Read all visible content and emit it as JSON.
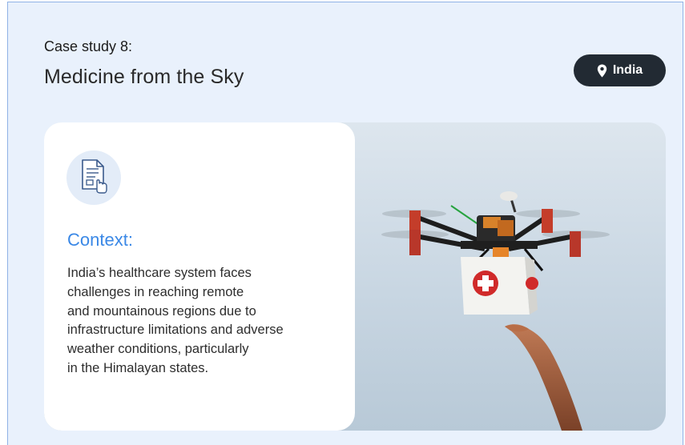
{
  "header": {
    "eyebrow": "Case study 8:",
    "title": "Medicine from the Sky"
  },
  "location_badge": {
    "label": "India",
    "icon": "map-pin-icon"
  },
  "context": {
    "icon": "document-touch-icon",
    "heading": "Context:",
    "lines": [
      "India’s healthcare system faces",
      "challenges in reaching remote",
      "and mountainous regions due to",
      "infrastructure limitations and adverse",
      "weather conditions, particularly",
      "in the Himalayan states."
    ]
  },
  "colors": {
    "page_background": "#e9f1fc",
    "badge_background": "#222a33",
    "heading_accent": "#3a88e6",
    "card_background": "#ffffff"
  }
}
